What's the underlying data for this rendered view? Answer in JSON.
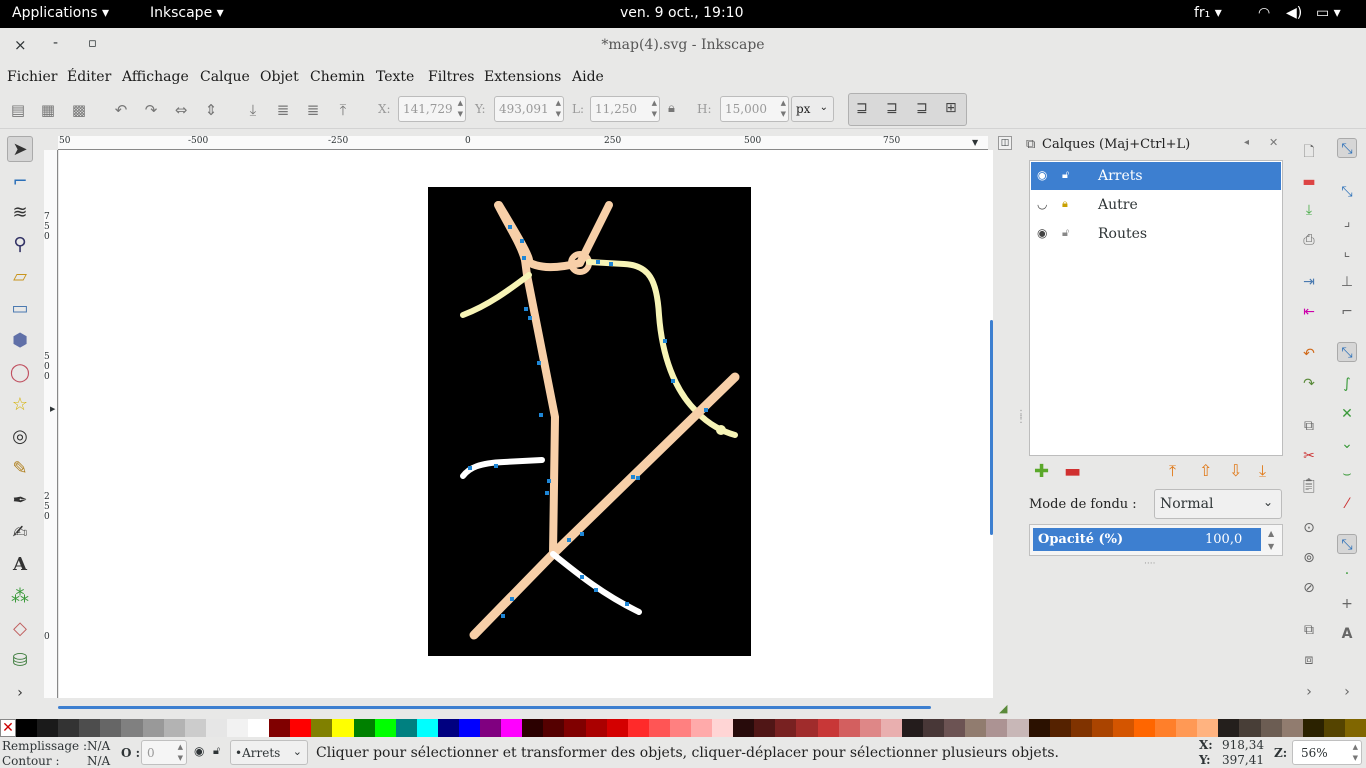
{
  "topbar": {
    "apps": "Applications ▾",
    "app": "Inkscape ▾",
    "datetime": "ven.  9 oct., 19:10",
    "kbd": "fr₁ ▾"
  },
  "window": {
    "title": "*map(4).svg - Inkscape",
    "close": "×",
    "minimize": "-",
    "maximize": "▫"
  },
  "menu": [
    "Fichier",
    "Éditer",
    "Affichage",
    "Calque",
    "Objet",
    "Chemin",
    "Texte",
    "Filtres",
    "Extensions",
    "Aide"
  ],
  "toolbar": {
    "x_label": "X:",
    "x_value": "141,729",
    "y_label": "Y:",
    "y_value": "493,091",
    "w_label": "L:",
    "w_value": "11,250",
    "h_label": "H:",
    "h_value": "15,000",
    "unit": "px"
  },
  "ruler": {
    "h_ticks": [
      "50",
      "-500",
      "-250",
      "0",
      "250",
      "500",
      "750"
    ],
    "v_ticks": [
      "7\n5\n0",
      "5\n0\n0",
      "2\n5\n0",
      "0"
    ]
  },
  "layers": {
    "title": "Calques (Maj+Ctrl+L)",
    "items": [
      {
        "name": "Arrets",
        "selected": true
      },
      {
        "name": "Autre",
        "selected": false
      },
      {
        "name": "Routes",
        "selected": false
      }
    ],
    "blend_label": "Mode de fondu :",
    "blend_value": "Normal",
    "opacity_label": "Opacité (%)",
    "opacity_value": "100,0"
  },
  "colors": {
    "accent": "#3d7fd0",
    "road": "#f7cfa8",
    "yellow": "#f7f4b6",
    "stop": "#1e86d6"
  },
  "status": {
    "fill_label": "Remplissage :",
    "fill_value": "N/A",
    "stroke_label": "Contour :",
    "stroke_value": "N/A",
    "o_label": "O :",
    "o_value": "0",
    "layer": "•Arrets",
    "message": "Cliquer pour sélectionner et transformer des objets, cliquer-déplacer pour sélectionner plusieurs objets.",
    "x_label": "X:",
    "x_value": "918,34",
    "y_label": "Y:",
    "y_value": "397,41",
    "z_label": "Z:",
    "zoom": "56%"
  }
}
